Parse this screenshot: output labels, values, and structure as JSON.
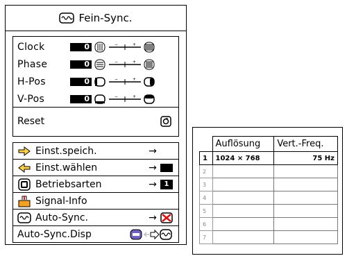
{
  "menu": {
    "title": "Fein-Sync.",
    "adjust_items": [
      {
        "label": "Clock",
        "value": "0"
      },
      {
        "label": "Phase",
        "value": "0"
      },
      {
        "label": "H-Pos",
        "value": "0"
      },
      {
        "label": "V-Pos",
        "value": "0"
      }
    ],
    "reset_label": "Reset",
    "items": [
      {
        "label": "Einst.speich.",
        "icon": "save-arrow-icon",
        "arrow": "→"
      },
      {
        "label": "Einst.wählen",
        "icon": "select-arrow-icon",
        "arrow": "→",
        "selected": true
      },
      {
        "label": "Betriebsarten",
        "icon": "modes-icon",
        "arrow": "→",
        "badge": "1"
      },
      {
        "label": "Signal-Info",
        "icon": "signal-info-icon"
      },
      {
        "label": "Auto-Sync.",
        "icon": "auto-sync-icon",
        "arrow": "→"
      },
      {
        "label": "Auto-Sync.Disp",
        "icon": ""
      }
    ]
  },
  "table": {
    "headers": [
      "Auflösung",
      "Vert.-Freq."
    ],
    "rows": [
      {
        "idx": "1",
        "resolution": "1024 × 768",
        "freq": "75  Hz"
      },
      {
        "idx": "2",
        "resolution": "",
        "freq": ""
      },
      {
        "idx": "3",
        "resolution": "",
        "freq": ""
      },
      {
        "idx": "4",
        "resolution": "",
        "freq": ""
      },
      {
        "idx": "5",
        "resolution": "",
        "freq": ""
      },
      {
        "idx": "6",
        "resolution": "",
        "freq": ""
      },
      {
        "idx": "7",
        "resolution": "",
        "freq": ""
      }
    ]
  }
}
